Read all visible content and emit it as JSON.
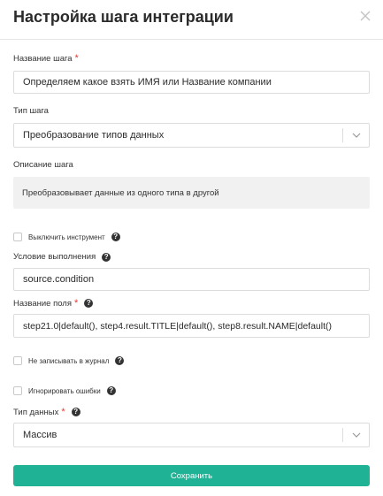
{
  "dialog": {
    "title": "Настройка шага интеграции"
  },
  "fields": {
    "step_name": {
      "label": "Название шага",
      "required_mark": "*",
      "value": "Определяем какое взять ИМЯ или Название компании"
    },
    "step_type": {
      "label": "Тип шага",
      "selected": "Преобразование типов данных"
    },
    "step_description": {
      "label": "Описание шага",
      "value": "Преобразовывает данные из одного типа в другой"
    },
    "disable_tool": {
      "label": "Выключить инструмент",
      "checked": false
    },
    "condition": {
      "label": "Условие выполнения",
      "value": "source.condition"
    },
    "field_name": {
      "label": "Название поля",
      "required_mark": "*",
      "value": "step21.0|default(), step4.result.TITLE|default(), step8.result.NAME|default()"
    },
    "no_log": {
      "label": "Не записывать в журнал",
      "checked": false
    },
    "ignore_errors": {
      "label": "Игнорировать ошибки",
      "checked": false
    },
    "data_type": {
      "label": "Тип данных",
      "required_mark": "*",
      "selected": "Массив"
    }
  },
  "help_glyph": "?",
  "actions": {
    "save_label": "Сохранить"
  },
  "colors": {
    "accent": "#1fb295",
    "required": "#e53935"
  },
  "icons": {
    "close": "close-icon",
    "help": "question-circle-icon",
    "dropdown": "chevron-down-icon"
  }
}
